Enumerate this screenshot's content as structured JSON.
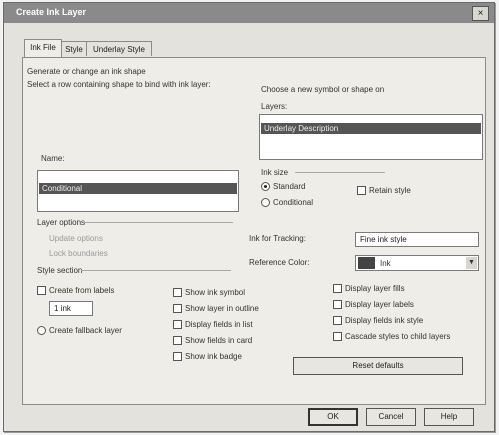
{
  "window": {
    "title": "Create Ink Layer",
    "close_glyph": "×"
  },
  "tabs": [
    "Ink File",
    "Style",
    "Underlay Style"
  ],
  "main": {
    "intro_line1": "Generate or change an ink shape",
    "intro_line2": "Select a row containing shape to bind with ink layer:",
    "right_caption": "Choose a new symbol or shape on",
    "name_label": "Name:",
    "name_selected": "Conditional",
    "layers_label": "Layers:",
    "layers_selected": "Underlay Description",
    "layer_options_label": "Layer options",
    "layer_opt_1": "Update options",
    "layer_opt_2": "Lock boundaries",
    "radio_group_label": "Ink size",
    "radio_a": "Standard",
    "radio_b": "Conditional",
    "retain_label": "Retain style",
    "style_section_label": "Style section",
    "create_from_labels": "Create from labels",
    "spinner_value": "1 ink",
    "create_fallback": "Create fallback layer",
    "midcol": [
      "Show ink symbol",
      "Show layer in outline",
      "Display fields in list",
      "Show fields in card",
      "Show ink badge"
    ],
    "rightcol": [
      "Display layer fills",
      "Display layer labels",
      "Display fields ink style",
      "Cascade styles to child layers"
    ],
    "theme_label": "Ink for Tracking:",
    "theme_value": "Fine ink style",
    "ref_color_label": "Reference Color:",
    "ref_color_value": "Ink",
    "ref_color": "#444444",
    "reset_button": "Reset defaults"
  },
  "footer": {
    "ok": "OK",
    "cancel": "Cancel",
    "help": "Help"
  }
}
